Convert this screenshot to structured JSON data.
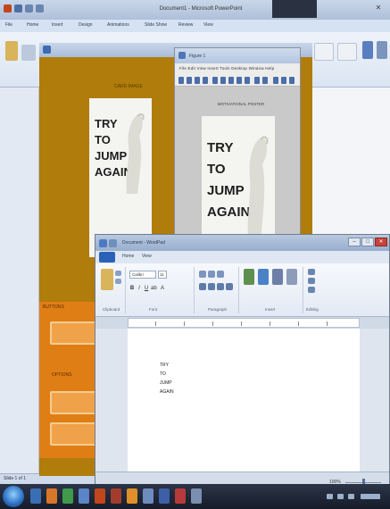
{
  "powerpoint": {
    "title": "Document1 - Microsoft PowerPoint",
    "tabs": [
      "File",
      "Home",
      "Insert",
      "Design",
      "Animations",
      "Slide Show",
      "Review",
      "View"
    ],
    "status_text": "Slide 1 of 1"
  },
  "paint_window": {
    "caption": "CARD IMAGE",
    "card_text": [
      "TRY",
      "TO",
      "JUMP",
      "AGAIN"
    ],
    "panel_top_label": "BUTTONS",
    "panel_mid_label": "OPTIONS"
  },
  "figure_window": {
    "title": "Figure 1",
    "menu": "File  Edit  View  Insert  Tools  Desktop  Window  Help",
    "caption": "MOTIVATIONAL POSTER",
    "card_text": [
      "TRY",
      "TO",
      "JUMP",
      "AGAIN"
    ]
  },
  "wordpad": {
    "title": "Document - WordPad",
    "tabs": [
      "Home",
      "View"
    ],
    "font": "Calibri",
    "size": "11",
    "groups": [
      "Clipboard",
      "Font",
      "Paragraph",
      "Insert",
      "Editing"
    ],
    "doc_lines": [
      "TRY",
      "TO",
      "JUMP",
      "AGAIN"
    ],
    "zoom": "100%"
  }
}
